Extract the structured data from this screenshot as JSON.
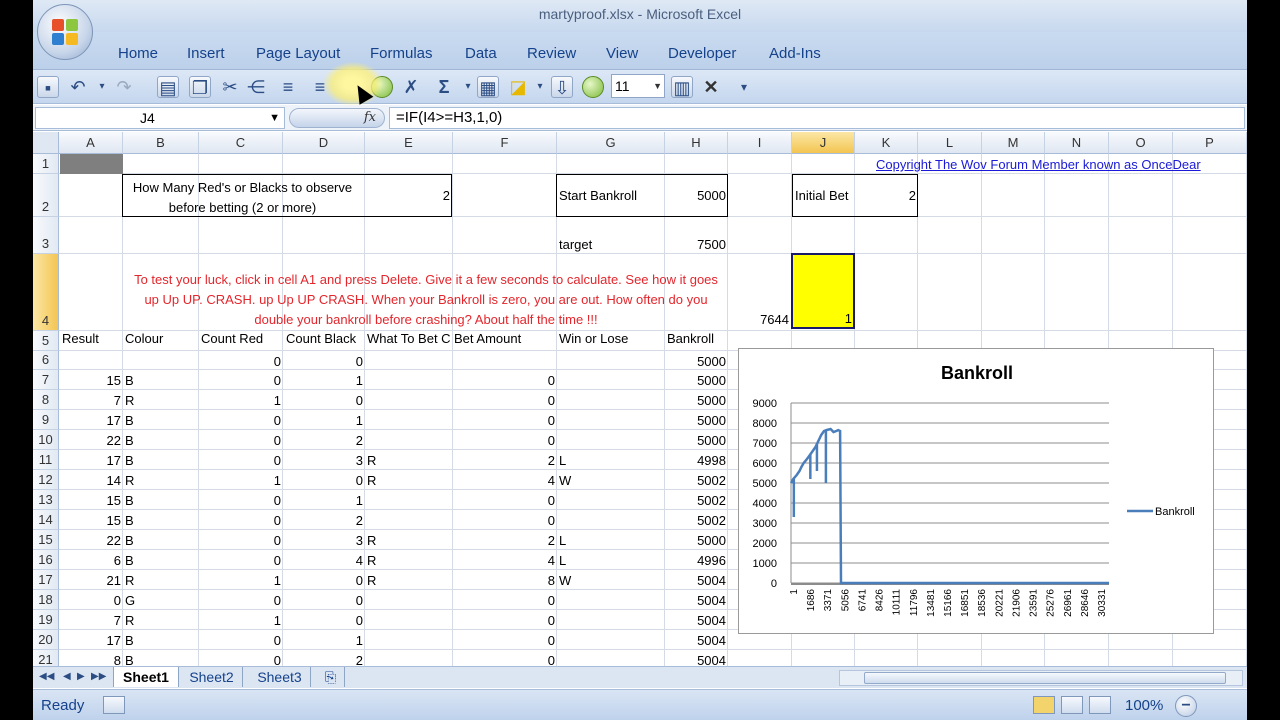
{
  "window": {
    "title": "martyproof.xlsx - Microsoft Excel"
  },
  "ribbon_tabs": [
    "Home",
    "Insert",
    "Page Layout",
    "Formulas",
    "Data",
    "Review",
    "View",
    "Developer",
    "Add-Ins"
  ],
  "toolbar": {
    "font_size": "11",
    "sum_symbol": "Σ"
  },
  "formula_bar": {
    "name_box": "J4",
    "fx_label": "fx",
    "formula": "=IF(I4>=H3,1,0)"
  },
  "columns": [
    "A",
    "B",
    "C",
    "D",
    "E",
    "F",
    "G",
    "H",
    "I",
    "J",
    "K",
    "L",
    "M",
    "N",
    "O",
    "P"
  ],
  "rows": [
    "1",
    "2",
    "3",
    "4",
    "5",
    "6",
    "7",
    "8",
    "9",
    "10",
    "11",
    "12",
    "13",
    "14",
    "15",
    "16",
    "17",
    "18",
    "19",
    "20",
    "21"
  ],
  "cells": {
    "b2": "How Many Red's or Blacks to observe before betting (2 or more)",
    "e2": "2",
    "g2": "Start Bankroll",
    "h2": "5000",
    "j2": "Initial Bet",
    "k2": "2",
    "g3": "target",
    "h3": "7500",
    "k1": "Copyright The Wov Forum Member known as OnceDear",
    "red_note": "To test your luck, click in cell A1 and press Delete. Give it a few seconds to calculate. See how it goes up Up UP. CRASH. up Up UP CRASH. When your Bankroll is zero, you are out. How often do you double your bankroll before crashing? About half the time !!!",
    "i4": "7644",
    "j4": "1"
  },
  "table_headers": [
    "Result",
    "Colour",
    "Count Red",
    "Count Black",
    "What To Bet C",
    "Bet Amount",
    "Win or Lose",
    "Bankroll"
  ],
  "table_rows": [
    {
      "a": "",
      "b": "",
      "c": "0",
      "d": "0",
      "e": "",
      "f": "",
      "g": "",
      "h": "5000"
    },
    {
      "a": "15",
      "b": "B",
      "c": "0",
      "d": "1",
      "e": "",
      "f": "0",
      "g": "",
      "h": "5000"
    },
    {
      "a": "7",
      "b": "R",
      "c": "1",
      "d": "0",
      "e": "",
      "f": "0",
      "g": "",
      "h": "5000"
    },
    {
      "a": "17",
      "b": "B",
      "c": "0",
      "d": "1",
      "e": "",
      "f": "0",
      "g": "",
      "h": "5000"
    },
    {
      "a": "22",
      "b": "B",
      "c": "0",
      "d": "2",
      "e": "",
      "f": "0",
      "g": "",
      "h": "5000"
    },
    {
      "a": "17",
      "b": "B",
      "c": "0",
      "d": "3",
      "e": "R",
      "f": "2",
      "g": "L",
      "h": "4998"
    },
    {
      "a": "14",
      "b": "R",
      "c": "1",
      "d": "0",
      "e": "R",
      "f": "4",
      "g": "W",
      "h": "5002"
    },
    {
      "a": "15",
      "b": "B",
      "c": "0",
      "d": "1",
      "e": "",
      "f": "0",
      "g": "",
      "h": "5002"
    },
    {
      "a": "15",
      "b": "B",
      "c": "0",
      "d": "2",
      "e": "",
      "f": "0",
      "g": "",
      "h": "5002"
    },
    {
      "a": "22",
      "b": "B",
      "c": "0",
      "d": "3",
      "e": "R",
      "f": "2",
      "g": "L",
      "h": "5000"
    },
    {
      "a": "6",
      "b": "B",
      "c": "0",
      "d": "4",
      "e": "R",
      "f": "4",
      "g": "L",
      "h": "4996"
    },
    {
      "a": "21",
      "b": "R",
      "c": "1",
      "d": "0",
      "e": "R",
      "f": "8",
      "g": "W",
      "h": "5004"
    },
    {
      "a": "0",
      "b": "G",
      "c": "0",
      "d": "0",
      "e": "",
      "f": "0",
      "g": "",
      "h": "5004"
    },
    {
      "a": "7",
      "b": "R",
      "c": "1",
      "d": "0",
      "e": "",
      "f": "0",
      "g": "",
      "h": "5004"
    },
    {
      "a": "17",
      "b": "B",
      "c": "0",
      "d": "1",
      "e": "",
      "f": "0",
      "g": "",
      "h": "5004"
    },
    {
      "a": "8",
      "b": "B",
      "c": "0",
      "d": "2",
      "e": "",
      "f": "0",
      "g": "",
      "h": "5004"
    }
  ],
  "chart_data": {
    "type": "line",
    "title": "Bankroll",
    "legend": "Bankroll",
    "legend_position": "right",
    "ylim": [
      0,
      9000
    ],
    "yticks": [
      "9000",
      "8000",
      "7000",
      "6000",
      "5000",
      "4000",
      "3000",
      "2000",
      "1000",
      "0"
    ],
    "xticks": [
      "1",
      "1686",
      "3371",
      "5056",
      "6741",
      "8426",
      "10111",
      "11796",
      "13481",
      "15166",
      "16851",
      "18536",
      "20221",
      "21906",
      "23591",
      "25276",
      "26961",
      "28646",
      "30331"
    ],
    "xlim": [
      1,
      33700
    ],
    "series": [
      {
        "name": "Bankroll",
        "x": [
          1,
          250,
          600,
          900,
          1100,
          1350,
          1700,
          2000,
          2300,
          2600,
          2800,
          3000,
          3200,
          3500,
          3800,
          4200,
          4500,
          4800,
          5000,
          5200,
          5300,
          5400,
          5500,
          33700
        ],
        "y": [
          5000,
          5200,
          5400,
          5600,
          5800,
          6000,
          6200,
          6400,
          6600,
          6800,
          7000,
          7200,
          7400,
          7600,
          7650,
          7700,
          7550,
          7600,
          7644,
          7600,
          0,
          0,
          0,
          0
        ]
      }
    ],
    "dips": [
      {
        "x": 300,
        "y": 3300
      },
      {
        "x": 2050,
        "y": 5200
      },
      {
        "x": 2750,
        "y": 5600
      },
      {
        "x": 3700,
        "y": 5000
      }
    ],
    "grid": true
  },
  "sheet_tabs": [
    "Sheet1",
    "Sheet2",
    "Sheet3"
  ],
  "status": {
    "ready": "Ready",
    "zoom": "100%"
  }
}
